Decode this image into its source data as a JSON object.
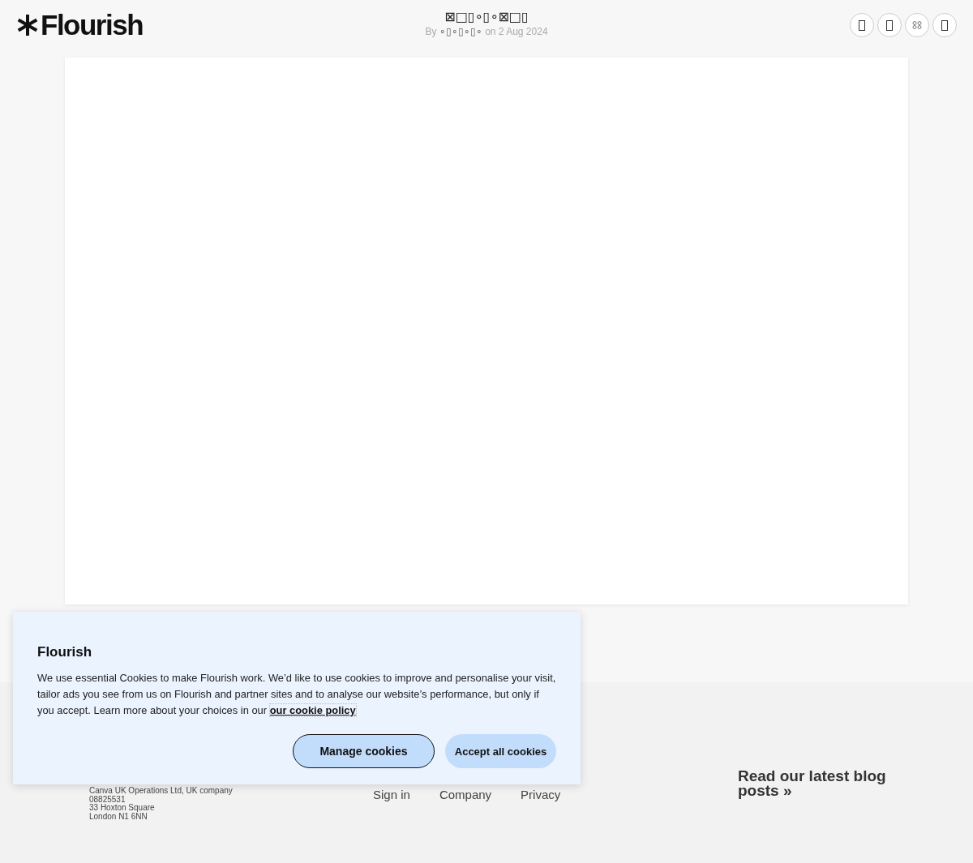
{
  "header": {
    "logo": "Flourish",
    "title": "⊠□▯∘▯∘⊠□▯",
    "byline": {
      "prefix": "By",
      "author": "∘▯∘▯∘▯∘",
      "date": "on 2 Aug 2024"
    },
    "icon_buttons": [
      {
        "kind": "box"
      },
      {
        "kind": "box"
      },
      {
        "kind": "hex"
      },
      {
        "kind": "box"
      }
    ]
  },
  "visualisation": {
    "kind": "empty"
  },
  "footer": {
    "address": [
      "Canva UK Operations Ltd, UK company",
      "08825531",
      "33 Hoxton Square",
      "London N1 6NN"
    ],
    "links": [
      "Sign in",
      "Company",
      "Privacy"
    ],
    "blog_link": "Read our latest blog posts »"
  },
  "cookie_banner": {
    "title": "Flourish",
    "text": "We use essential Cookies to make Flourish work. We’d like to use cookies to improve and personalise your visit, tailor ads you see from us on Flourish and partner sites and to analyse our website’s performance, but only if you accept. Learn more about your choices in our",
    "policy_link": "our cookie policy",
    "buttons": [
      {
        "label": "Manage cookies",
        "kind": "outline"
      },
      {
        "label": "Accept all cookies",
        "kind": "filled"
      }
    ]
  }
}
